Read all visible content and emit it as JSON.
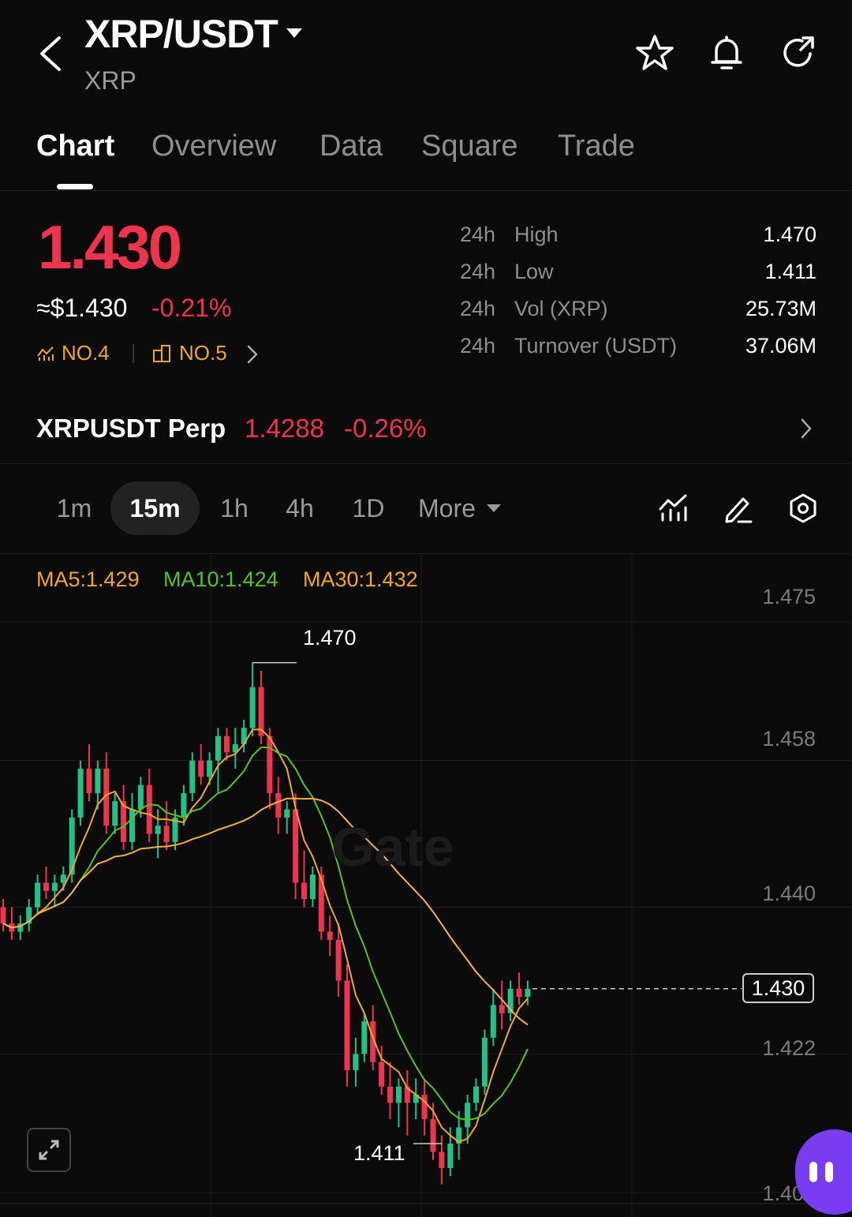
{
  "header": {
    "pair": "XRP/USDT",
    "sub": "XRP"
  },
  "tabs": [
    {
      "label": "Chart"
    },
    {
      "label": "Overview"
    },
    {
      "label": "Data"
    },
    {
      "label": "Square"
    },
    {
      "label": "Trade"
    }
  ],
  "price": {
    "last": "1.430",
    "usd": "≈$1.430",
    "change": "-0.21%",
    "rank_market": "NO.4",
    "rank_sector": "NO.5"
  },
  "stats": [
    {
      "period": "24h",
      "label": "High",
      "value": "1.470"
    },
    {
      "period": "24h",
      "label": "Low",
      "value": "1.411"
    },
    {
      "period": "24h",
      "label": "Vol (XRP)",
      "value": "25.73M"
    },
    {
      "period": "24h",
      "label": "Turnover (USDT)",
      "value": "37.06M"
    }
  ],
  "perp": {
    "name": "XRPUSDT Perp",
    "price": "1.4288",
    "change": "-0.26%"
  },
  "intervals": {
    "items": [
      "1m",
      "15m",
      "1h",
      "4h",
      "1D"
    ],
    "active": "15m",
    "more": "More"
  },
  "chart": {
    "ma5": "MA5:1.429",
    "ma10": "MA10:1.424",
    "ma30": "MA30:1.432",
    "y_labels": [
      "1.475",
      "1.458",
      "1.440",
      "1.422",
      "1.405"
    ],
    "high_label": "1.470",
    "low_label": "1.411",
    "current_tag": "1.430",
    "watermark": "Gate"
  },
  "colors": {
    "up": "#1fc387",
    "down": "#f0334f",
    "ma5": "#f5a623",
    "ma10": "#52c41a",
    "ma30": "#f5a623",
    "accent": "#7a3cf0"
  },
  "icons": [
    "back-arrow-icon",
    "caret-down-icon",
    "star-icon",
    "bell-icon",
    "refresh-icon",
    "chevron-right-icon",
    "indicator-icon",
    "draw-icon",
    "settings-icon",
    "expand-icon"
  ],
  "chart_data": {
    "type": "candlestick",
    "y_ticks": [
      1.475,
      1.458,
      1.44,
      1.422,
      1.405
    ],
    "ylim": [
      1.405,
      1.478
    ],
    "high": 1.47,
    "low": 1.411,
    "last": 1.43,
    "candles": [
      [
        1.44,
        1.441,
        1.437,
        1.438
      ],
      [
        1.438,
        1.44,
        1.436,
        1.437
      ],
      [
        1.437,
        1.439,
        1.436,
        1.438
      ],
      [
        1.438,
        1.441,
        1.437,
        1.44
      ],
      [
        1.44,
        1.444,
        1.439,
        1.443
      ],
      [
        1.443,
        1.445,
        1.441,
        1.442
      ],
      [
        1.442,
        1.444,
        1.44,
        1.443
      ],
      [
        1.443,
        1.445,
        1.442,
        1.444
      ],
      [
        1.444,
        1.452,
        1.443,
        1.451
      ],
      [
        1.451,
        1.458,
        1.45,
        1.457
      ],
      [
        1.457,
        1.46,
        1.453,
        1.454
      ],
      [
        1.454,
        1.458,
        1.452,
        1.457
      ],
      [
        1.457,
        1.459,
        1.449,
        1.45
      ],
      [
        1.45,
        1.454,
        1.449,
        1.453
      ],
      [
        1.453,
        1.455,
        1.447,
        1.448
      ],
      [
        1.448,
        1.454,
        1.447,
        1.452
      ],
      [
        1.452,
        1.456,
        1.451,
        1.455
      ],
      [
        1.455,
        1.457,
        1.448,
        1.449
      ],
      [
        1.449,
        1.452,
        1.446,
        1.45
      ],
      [
        1.45,
        1.453,
        1.447,
        1.448
      ],
      [
        1.448,
        1.452,
        1.447,
        1.451
      ],
      [
        1.451,
        1.455,
        1.45,
        1.454
      ],
      [
        1.454,
        1.459,
        1.453,
        1.458
      ],
      [
        1.458,
        1.46,
        1.455,
        1.456
      ],
      [
        1.456,
        1.459,
        1.455,
        1.458
      ],
      [
        1.458,
        1.462,
        1.454,
        1.461
      ],
      [
        1.461,
        1.462,
        1.458,
        1.459
      ],
      [
        1.459,
        1.462,
        1.457,
        1.46
      ],
      [
        1.46,
        1.463,
        1.459,
        1.462
      ],
      [
        1.462,
        1.47,
        1.461,
        1.467
      ],
      [
        1.467,
        1.469,
        1.46,
        1.461
      ],
      [
        1.461,
        1.462,
        1.452,
        1.454
      ],
      [
        1.454,
        1.456,
        1.449,
        1.451
      ],
      [
        1.451,
        1.453,
        1.449,
        1.452
      ],
      [
        1.452,
        1.454,
        1.441,
        1.443
      ],
      [
        1.443,
        1.447,
        1.44,
        1.441
      ],
      [
        1.441,
        1.445,
        1.44,
        1.444
      ],
      [
        1.444,
        1.445,
        1.436,
        1.437
      ],
      [
        1.437,
        1.439,
        1.434,
        1.436
      ],
      [
        1.436,
        1.438,
        1.429,
        1.431
      ],
      [
        1.431,
        1.433,
        1.418,
        1.42
      ],
      [
        1.42,
        1.424,
        1.418,
        1.422
      ],
      [
        1.422,
        1.427,
        1.421,
        1.426
      ],
      [
        1.426,
        1.428,
        1.42,
        1.421
      ],
      [
        1.421,
        1.423,
        1.417,
        1.418
      ],
      [
        1.418,
        1.421,
        1.414,
        1.416
      ],
      [
        1.416,
        1.419,
        1.413,
        1.418
      ],
      [
        1.418,
        1.42,
        1.412,
        1.416
      ],
      [
        1.416,
        1.419,
        1.414,
        1.417
      ],
      [
        1.417,
        1.419,
        1.412,
        1.414
      ],
      [
        1.414,
        1.416,
        1.409,
        1.41
      ],
      [
        1.41,
        1.412,
        1.406,
        1.408
      ],
      [
        1.408,
        1.413,
        1.407,
        1.411
      ],
      [
        1.411,
        1.415,
        1.409,
        1.413
      ],
      [
        1.413,
        1.417,
        1.411,
        1.416
      ],
      [
        1.416,
        1.419,
        1.415,
        1.418
      ],
      [
        1.418,
        1.425,
        1.417,
        1.424
      ],
      [
        1.424,
        1.43,
        1.423,
        1.428
      ],
      [
        1.428,
        1.431,
        1.425,
        1.427
      ],
      [
        1.427,
        1.431,
        1.426,
        1.43
      ],
      [
        1.43,
        1.432,
        1.428,
        1.429
      ],
      [
        1.429,
        1.431,
        1.428,
        1.43
      ]
    ]
  }
}
